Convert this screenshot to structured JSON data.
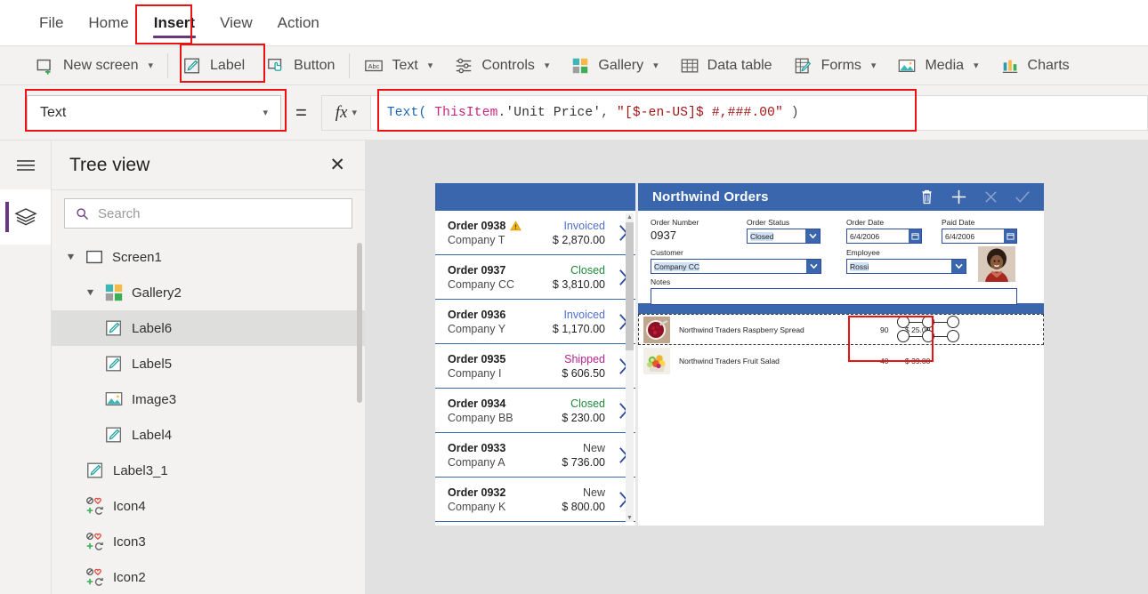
{
  "menu": {
    "tabs": [
      {
        "label": "File",
        "active": false
      },
      {
        "label": "Home",
        "active": false
      },
      {
        "label": "Insert",
        "active": true
      },
      {
        "label": "View",
        "active": false
      },
      {
        "label": "Action",
        "active": false
      }
    ]
  },
  "ribbon": {
    "items": [
      {
        "label": "New screen",
        "icon": "new-screen-icon",
        "caret": true,
        "highlight": false
      },
      {
        "label": "Label",
        "icon": "label-icon",
        "caret": false,
        "highlight": true
      },
      {
        "label": "Button",
        "icon": "button-icon",
        "caret": false,
        "highlight": false
      },
      {
        "label": "Text",
        "icon": "text-abc-icon",
        "caret": true,
        "highlight": false
      },
      {
        "label": "Controls",
        "icon": "controls-sliders-icon",
        "caret": true,
        "highlight": false
      },
      {
        "label": "Gallery",
        "icon": "gallery-icon",
        "caret": true,
        "highlight": false
      },
      {
        "label": "Data table",
        "icon": "data-table-icon",
        "caret": false,
        "highlight": false
      },
      {
        "label": "Forms",
        "icon": "forms-icon",
        "caret": true,
        "highlight": false
      },
      {
        "label": "Media",
        "icon": "media-image-icon",
        "caret": true,
        "highlight": false
      },
      {
        "label": "Charts",
        "icon": "charts-icon",
        "caret": false,
        "highlight": false
      }
    ]
  },
  "formula": {
    "property_selected": "Text",
    "equals": "=",
    "fx_label": "fx",
    "tokens": [
      {
        "t": "Text(",
        "c": "fn"
      },
      {
        "t": " ",
        "c": "p"
      },
      {
        "t": "ThisItem",
        "c": "obj"
      },
      {
        "t": ".",
        "c": "p"
      },
      {
        "t": "'Unit Price'",
        "c": "id"
      },
      {
        "t": ",",
        "c": "p"
      },
      {
        "t": " ",
        "c": "p"
      },
      {
        "t": "\"[$-en-US]$ #,###.00\"",
        "c": "str"
      },
      {
        "t": " )",
        "c": "p"
      }
    ],
    "full_text": "Text( ThisItem.'Unit Price', \"[$-en-US]$ #,###.00\" )"
  },
  "rail": {
    "menu_icon": "hamburger-menu-icon",
    "tree_icon": "layers-icon"
  },
  "treeview": {
    "title": "Tree view",
    "close": "✕",
    "search_placeholder": "Search",
    "nodes": [
      {
        "label": "Screen1",
        "icon": "screen-icon",
        "indent": 0,
        "twisty": "expanded",
        "selected": false
      },
      {
        "label": "Gallery2",
        "icon": "gallery-icon",
        "indent": 1,
        "twisty": "expanded",
        "selected": false
      },
      {
        "label": "Label6",
        "icon": "label-icon",
        "indent": 2,
        "twisty": "none",
        "selected": true
      },
      {
        "label": "Label5",
        "icon": "label-icon",
        "indent": 2,
        "twisty": "none",
        "selected": false
      },
      {
        "label": "Image3",
        "icon": "image-icon",
        "indent": 2,
        "twisty": "none",
        "selected": false
      },
      {
        "label": "Label4",
        "icon": "label-icon",
        "indent": 2,
        "twisty": "none",
        "selected": false
      },
      {
        "label": "Label3_1",
        "icon": "label-icon",
        "indent": 1,
        "twisty": "none",
        "selected": false
      },
      {
        "label": "Icon4",
        "icon": "icons-icon",
        "indent": 1,
        "twisty": "none",
        "selected": false
      },
      {
        "label": "Icon3",
        "icon": "icons-icon",
        "indent": 1,
        "twisty": "none",
        "selected": false
      },
      {
        "label": "Icon2",
        "icon": "icons-icon",
        "indent": 1,
        "twisty": "none",
        "selected": false
      }
    ]
  },
  "app": {
    "header_title": "Northwind Orders",
    "header_icons": [
      {
        "name": "delete-icon",
        "dim": false
      },
      {
        "name": "add-icon",
        "dim": false
      },
      {
        "name": "cancel-icon",
        "dim": true
      },
      {
        "name": "save-check-icon",
        "dim": true
      }
    ],
    "gallery": {
      "orders": [
        {
          "order": "Order 0938",
          "company": "Company T",
          "status": "Invoiced",
          "status_color": "#4f6fd0",
          "amount": "$ 2,870.00",
          "warning": true
        },
        {
          "order": "Order 0937",
          "company": "Company CC",
          "status": "Closed",
          "status_color": "#1f8a3b",
          "amount": "$ 3,810.00",
          "warning": false
        },
        {
          "order": "Order 0936",
          "company": "Company Y",
          "status": "Invoiced",
          "status_color": "#4f6fd0",
          "amount": "$ 1,170.00",
          "warning": false
        },
        {
          "order": "Order 0935",
          "company": "Company I",
          "status": "Shipped",
          "status_color": "#b5238e",
          "amount": "$ 606.50",
          "warning": false
        },
        {
          "order": "Order 0934",
          "company": "Company BB",
          "status": "Closed",
          "status_color": "#1f8a3b",
          "amount": "$ 230.00",
          "warning": false
        },
        {
          "order": "Order 0933",
          "company": "Company A",
          "status": "New",
          "status_color": "#444444",
          "amount": "$ 736.00",
          "warning": false
        },
        {
          "order": "Order 0932",
          "company": "Company K",
          "status": "New",
          "status_color": "#444444",
          "amount": "$ 800.00",
          "warning": false
        }
      ]
    },
    "form": {
      "order_number_label": "Order Number",
      "order_number_value": "0937",
      "order_status_label": "Order Status",
      "order_status_value": "Closed",
      "order_date_label": "Order Date",
      "order_date_value": "6/4/2006",
      "paid_date_label": "Paid Date",
      "paid_date_value": "6/4/2006",
      "customer_label": "Customer",
      "customer_value": "Company CC",
      "employee_label": "Employee",
      "employee_value": "Rossi",
      "notes_label": "Notes",
      "notes_value": ""
    },
    "detail_gallery": {
      "rows": [
        {
          "product": "Northwind Traders Raspberry Spread",
          "qty": "90",
          "price": "$ 25.00",
          "selected": true,
          "img": "raspberry-spread-photo"
        },
        {
          "product": "Northwind Traders Fruit Salad",
          "qty": "40",
          "price": "$ 39.00",
          "selected": false,
          "img": "fruit-salad-photo"
        }
      ]
    }
  },
  "colors": {
    "accent_purple": "#68387f",
    "app_blue": "#3a66ad",
    "highlight_red": "#ee1111",
    "canvas_bg": "#e1e1e1"
  }
}
